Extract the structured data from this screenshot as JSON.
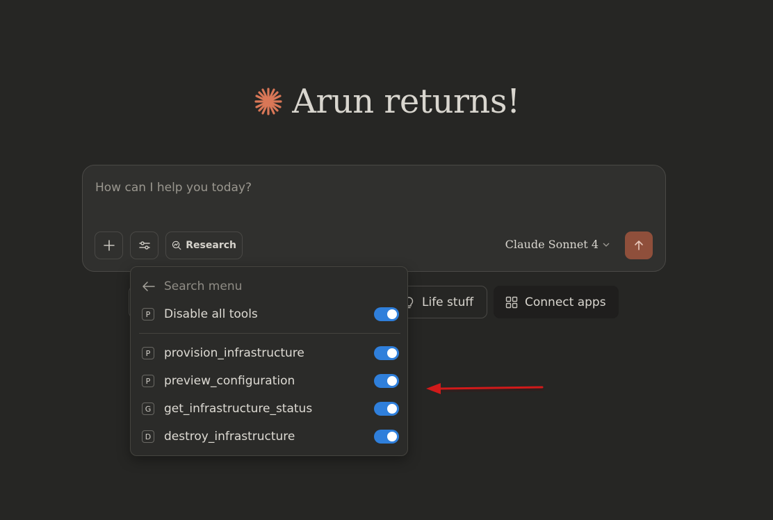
{
  "greeting": {
    "title": "Arun returns!"
  },
  "composer": {
    "placeholder": "How can I help you today?",
    "research_label": "Research",
    "model_label": "Claude Sonnet 4"
  },
  "chips": {
    "life_stuff": "Life stuff",
    "connect_apps": "Connect apps"
  },
  "menu": {
    "search_placeholder": "Search menu",
    "disable_all": {
      "badge": "P",
      "label": "Disable all tools",
      "enabled": true
    },
    "tools": [
      {
        "badge": "P",
        "label": "provision_infrastructure",
        "enabled": true
      },
      {
        "badge": "P",
        "label": "preview_configuration",
        "enabled": true
      },
      {
        "badge": "G",
        "label": "get_infrastructure_status",
        "enabled": true
      },
      {
        "badge": "D",
        "label": "destroy_infrastructure",
        "enabled": true
      }
    ]
  },
  "colors": {
    "background": "#262624",
    "accent_logo": "#d97757",
    "send_button": "#8f4f3b",
    "toggle_on": "#2f7fdb",
    "annotation_arrow": "#d11a1a"
  },
  "icons": [
    "spark-logo-icon",
    "plus-icon",
    "sliders-icon",
    "research-icon",
    "chevron-down-icon",
    "arrow-up-icon",
    "arrow-left-icon",
    "lightbulb-icon",
    "grid-icon",
    "red-arrow-icon"
  ]
}
